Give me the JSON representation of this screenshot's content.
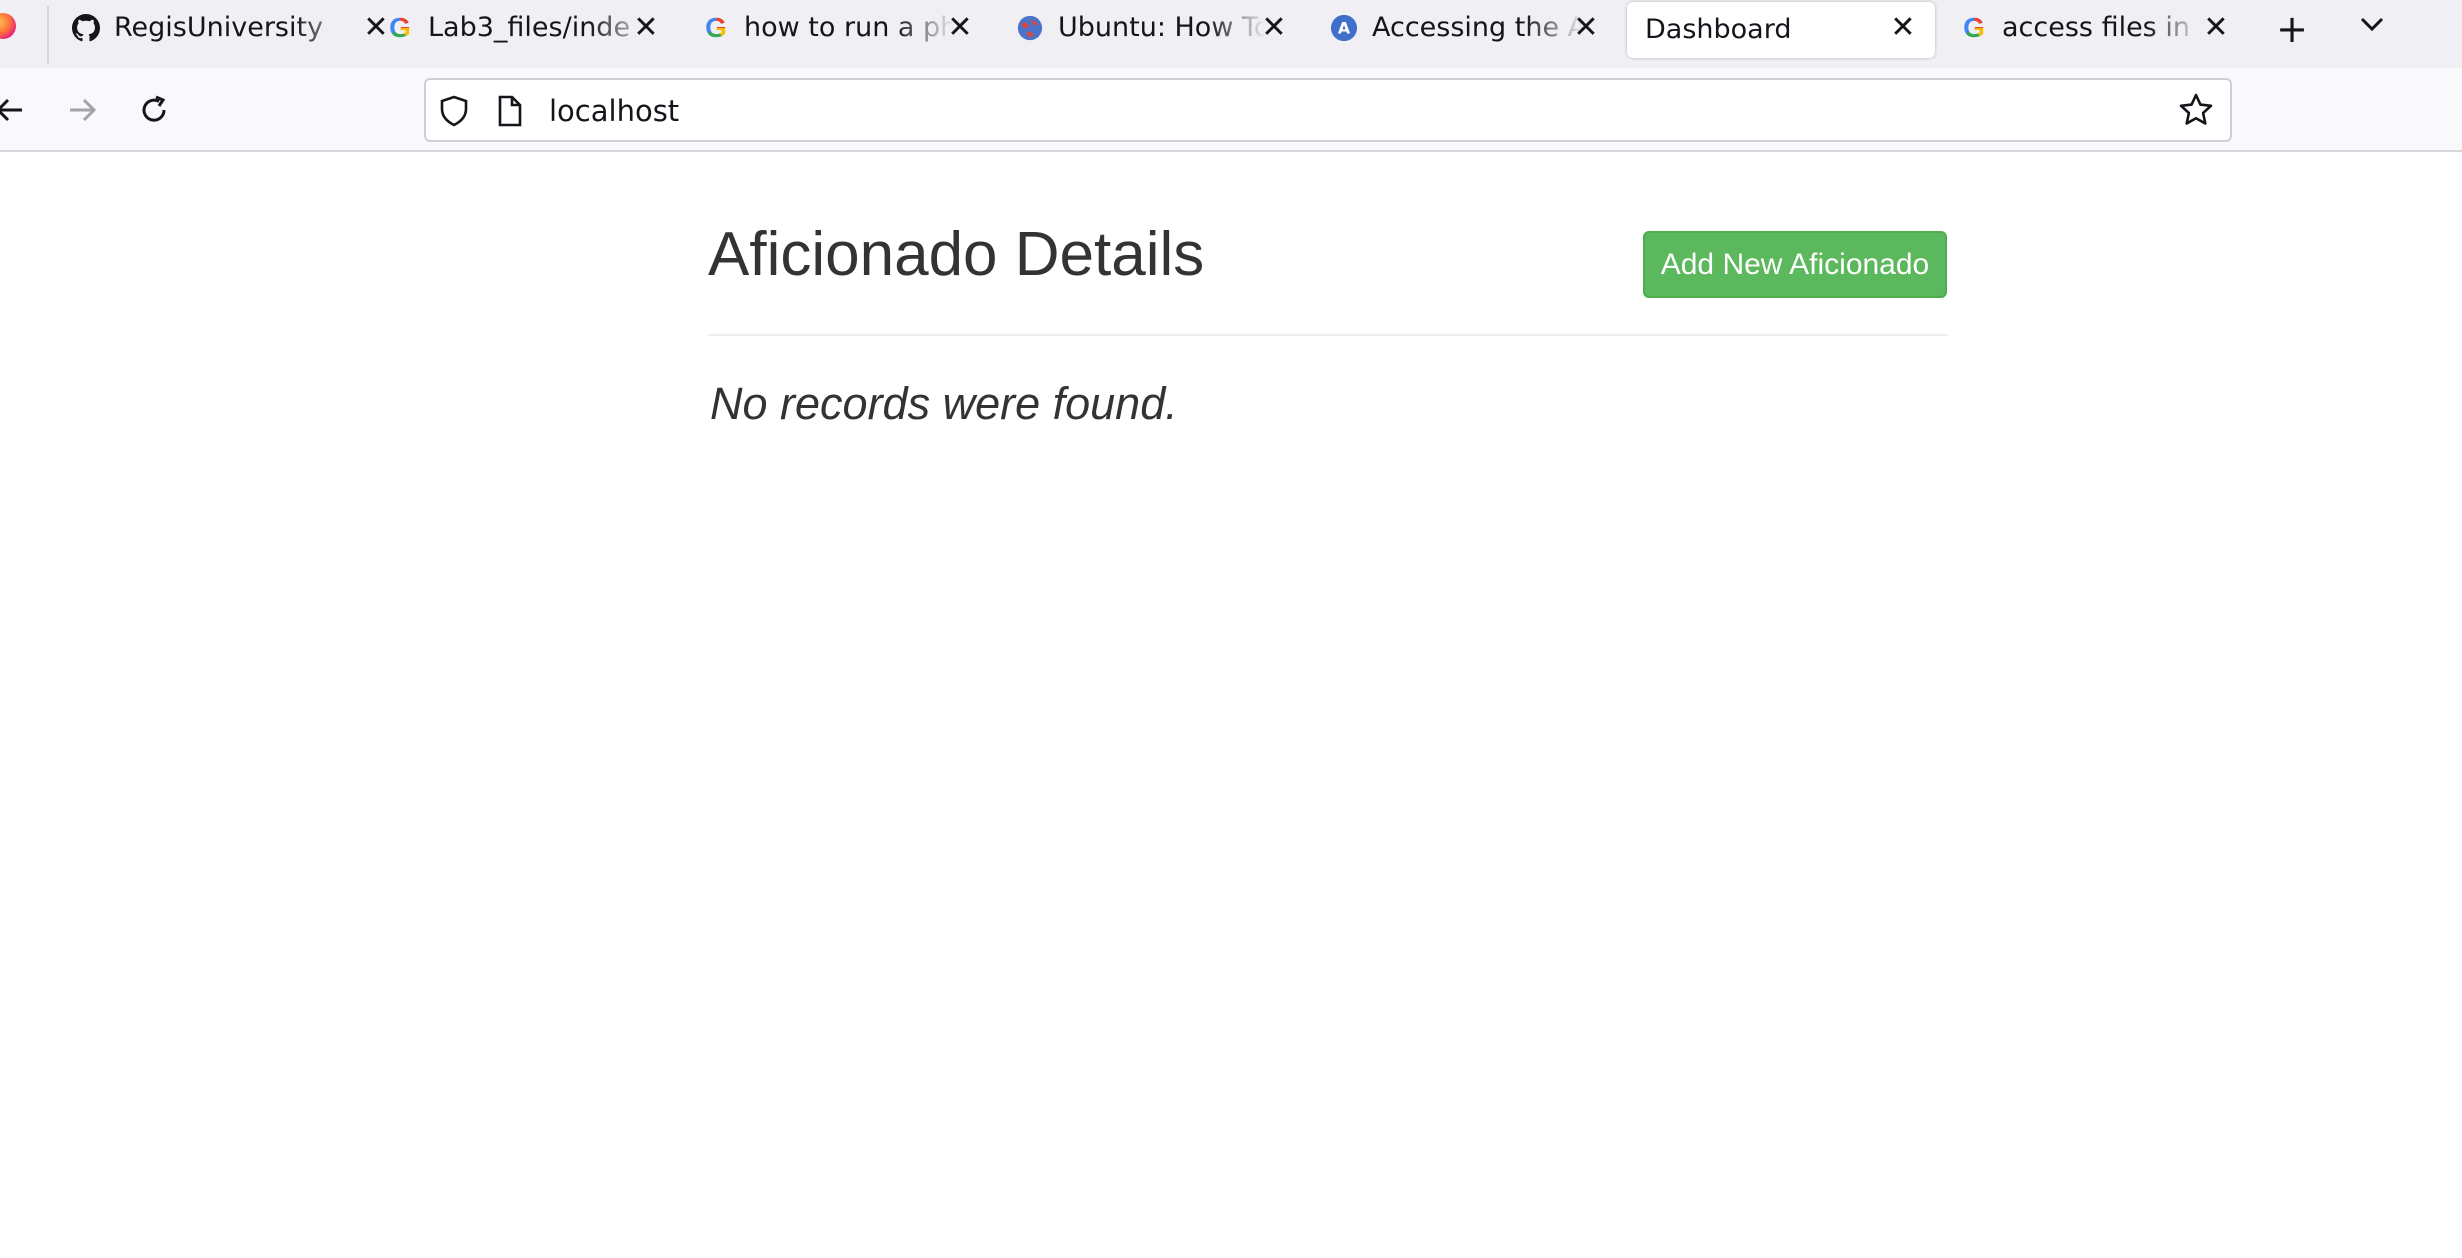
{
  "browser": {
    "tabs": [
      {
        "title": "RegisUniversity",
        "favicon": "github-icon",
        "active": false
      },
      {
        "title": "Lab3_files/inde",
        "favicon": "google-icon",
        "active": false
      },
      {
        "title": "how to run a ph",
        "favicon": "google-icon",
        "active": false
      },
      {
        "title": "Ubuntu: How To",
        "favicon": "globe-icon",
        "active": false
      },
      {
        "title": "Accessing the A",
        "favicon": "a-circle-icon",
        "active": false
      },
      {
        "title": "Dashboard",
        "favicon": "",
        "active": true
      },
      {
        "title": "access files in a",
        "favicon": "google-icon",
        "active": false
      }
    ],
    "close_glyph": "✕",
    "new_tab_glyph": "+",
    "url": "localhost"
  },
  "page": {
    "title": "Aficionado Details",
    "add_button_label": "Add New Aficionado",
    "empty_message": "No records were found."
  },
  "colors": {
    "success": "#5cb85c",
    "text": "#333333"
  }
}
